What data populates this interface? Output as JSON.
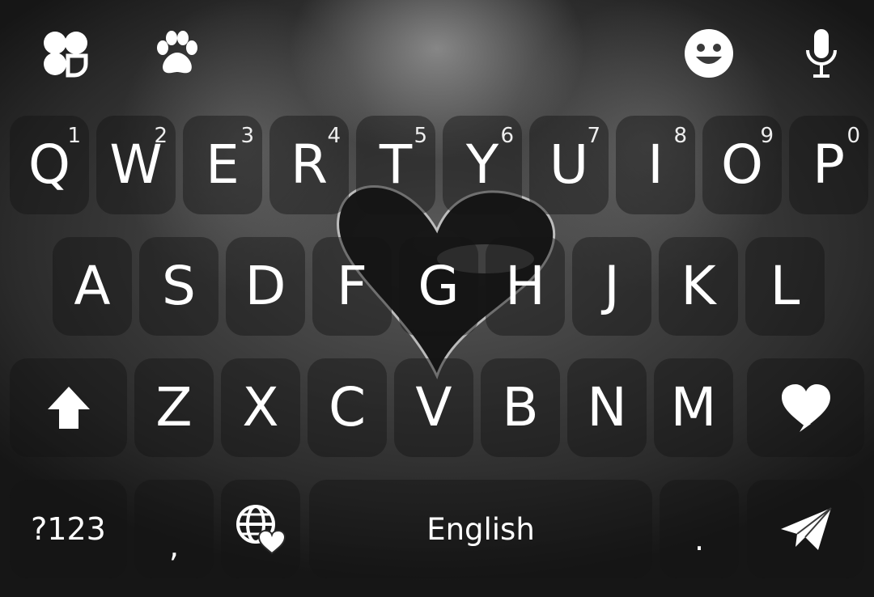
{
  "toolbar": {
    "left_icons": [
      "clover-icon",
      "paw-icon"
    ],
    "right_icons": [
      "emoji-icon",
      "microphone-icon"
    ]
  },
  "keyboard": {
    "row1": [
      {
        "label": "Q",
        "hint": "1"
      },
      {
        "label": "W",
        "hint": "2"
      },
      {
        "label": "E",
        "hint": "3"
      },
      {
        "label": "R",
        "hint": "4"
      },
      {
        "label": "T",
        "hint": "5"
      },
      {
        "label": "Y",
        "hint": "6"
      },
      {
        "label": "U",
        "hint": "7"
      },
      {
        "label": "I",
        "hint": "8"
      },
      {
        "label": "O",
        "hint": "9"
      },
      {
        "label": "P",
        "hint": "0"
      }
    ],
    "row2": [
      "A",
      "S",
      "D",
      "F",
      "G",
      "H",
      "J",
      "K",
      "L"
    ],
    "row3": [
      "Z",
      "X",
      "C",
      "V",
      "B",
      "N",
      "M"
    ],
    "symbols_label": "?123",
    "comma_label": ",",
    "space_label": "English",
    "period_label": "."
  },
  "colors": {
    "key_text": "#ffffff",
    "key_bg": "rgba(20,20,20,0.45)"
  }
}
